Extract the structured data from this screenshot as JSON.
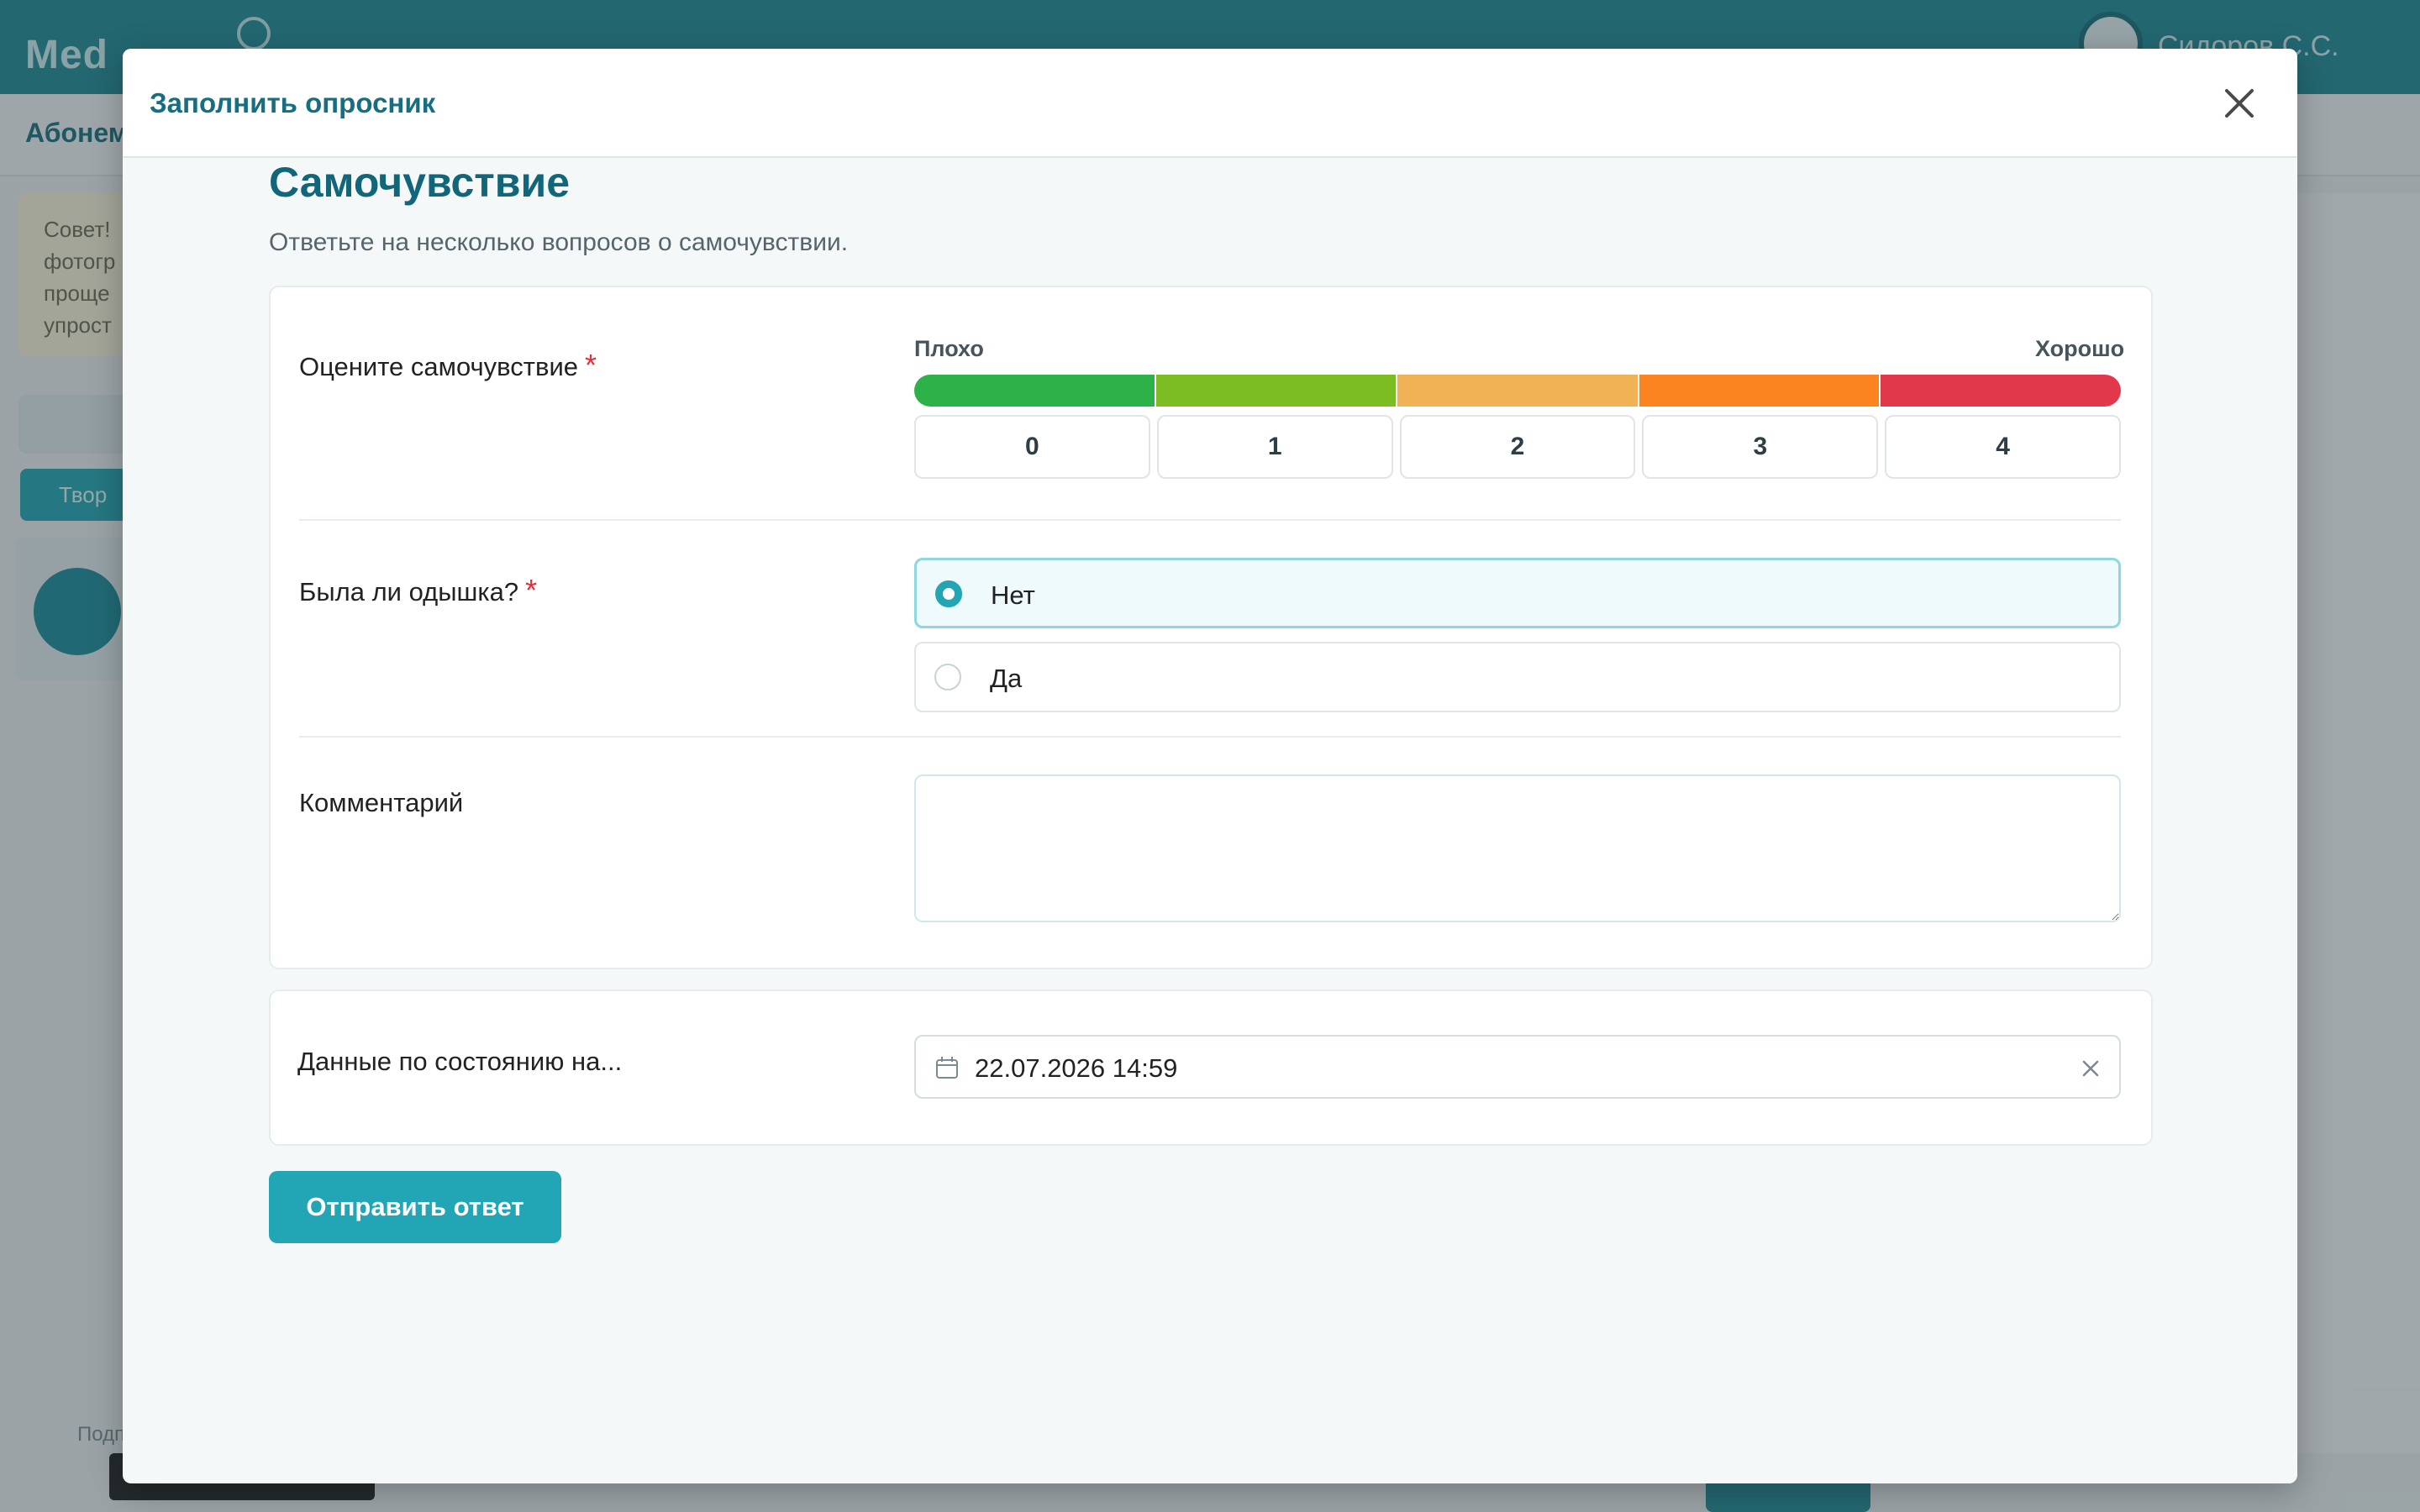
{
  "background": {
    "app_name": "Med",
    "user_name": "Сидоров С.С.",
    "subnav_label": "Абонем",
    "tip_text": "Совет! фотогр проще упрост",
    "teal_button": "Твор",
    "bottom_label": "Подп"
  },
  "modal": {
    "title": "Заполнить опросник",
    "section_title": "Самочувствие",
    "section_subtitle": "Ответьте на несколько вопросов о самочувствии.",
    "q1": {
      "label": "Оцените самочувствие",
      "required_mark": "*",
      "scale_low": "Плохо",
      "scale_high": "Хорошо",
      "options": [
        "0",
        "1",
        "2",
        "3",
        "4"
      ],
      "colors": [
        "#2db24a",
        "#7bbd22",
        "#f1b155",
        "#fb8320",
        "#e2384b"
      ]
    },
    "q2": {
      "label": "Была ли одышка?",
      "required_mark": "*",
      "options": [
        "Нет",
        "Да"
      ],
      "selected": "Нет"
    },
    "q3": {
      "label": "Комментарий",
      "value": ""
    },
    "date": {
      "label": "Данные по состоянию на...",
      "value": "22.07.2026 14:59"
    },
    "submit_label": "Отправить ответ"
  },
  "colors": {
    "accent": "#22a6b5",
    "title": "#12667a",
    "header_bg": "#1f8a98"
  }
}
